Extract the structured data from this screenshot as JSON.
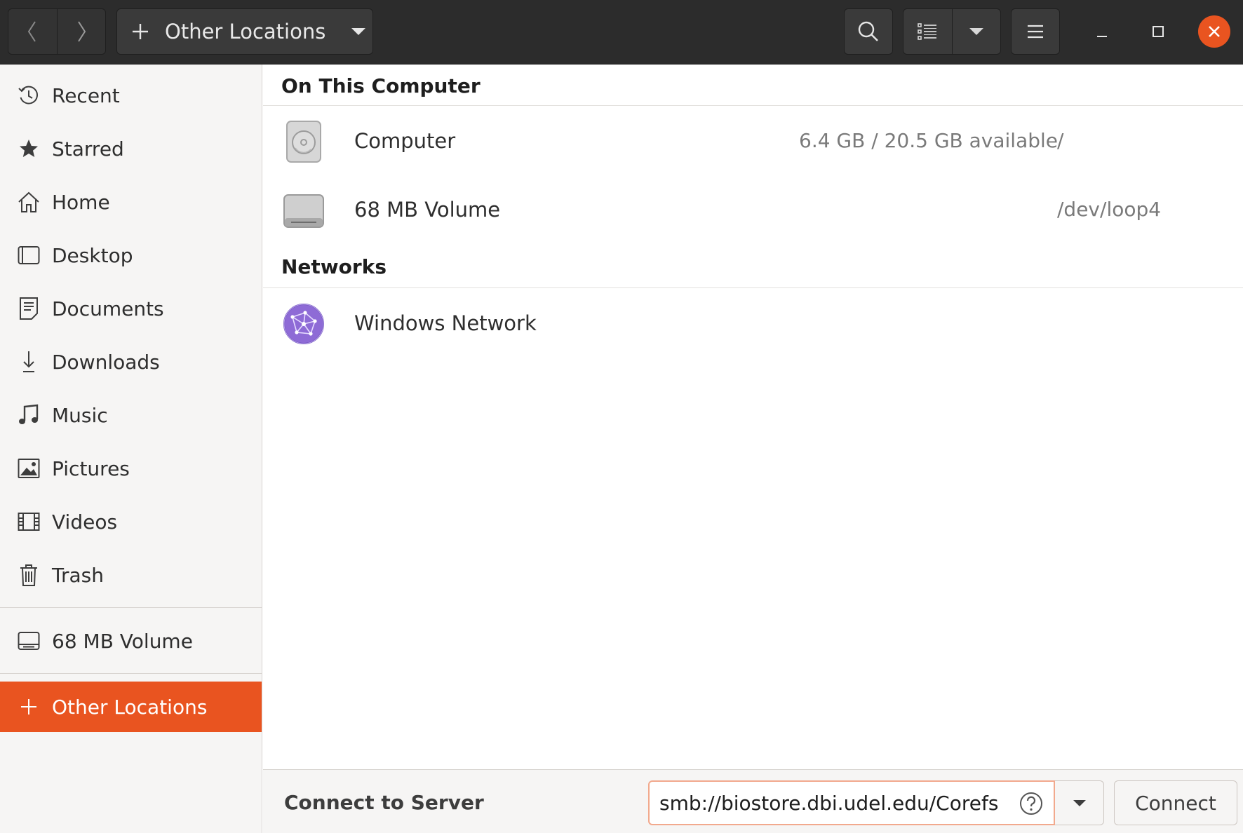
{
  "header": {
    "location_label": "Other Locations",
    "colors": {
      "bar": "#2c2c2c",
      "close": "#e95420"
    }
  },
  "sidebar": {
    "places": [
      {
        "label": "Recent",
        "icon": "clock-icon"
      },
      {
        "label": "Starred",
        "icon": "star-icon"
      },
      {
        "label": "Home",
        "icon": "home-icon"
      },
      {
        "label": "Desktop",
        "icon": "desktop-icon"
      },
      {
        "label": "Documents",
        "icon": "document-icon"
      },
      {
        "label": "Downloads",
        "icon": "download-icon"
      },
      {
        "label": "Music",
        "icon": "music-icon"
      },
      {
        "label": "Pictures",
        "icon": "picture-icon"
      },
      {
        "label": "Videos",
        "icon": "video-icon"
      },
      {
        "label": "Trash",
        "icon": "trash-icon"
      }
    ],
    "devices": [
      {
        "label": "68 MB Volume",
        "icon": "drive-icon"
      }
    ],
    "other_locations": {
      "label": "Other Locations",
      "icon": "plus-icon"
    },
    "accent": "#e95420"
  },
  "main": {
    "on_this_computer": {
      "title": "On This Computer",
      "items": [
        {
          "name": "Computer",
          "available": "6.4 GB / 20.5 GB available",
          "path": "/",
          "icon": "harddisk-icon"
        },
        {
          "name": "68 MB Volume",
          "available": "",
          "path": "/dev/loop4",
          "icon": "removable-drive-icon"
        }
      ]
    },
    "networks": {
      "title": "Networks",
      "items": [
        {
          "name": "Windows Network",
          "icon": "network-globe-icon"
        }
      ]
    }
  },
  "connect": {
    "label": "Connect to Server",
    "server_value": "smb://biostore.dbi.udel.edu/Corefs",
    "button_label": "Connect"
  }
}
